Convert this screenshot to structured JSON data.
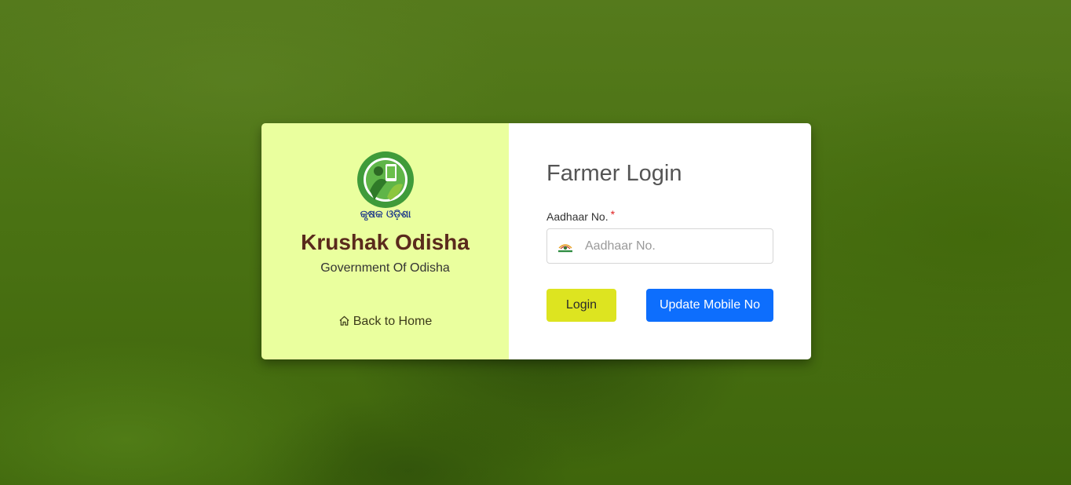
{
  "brand": {
    "logo_text": "କୃଷକ ଓଡ଼ିଶା",
    "title": "Krushak Odisha",
    "subtitle": "Government Of Odisha",
    "back_home_label": "Back to Home",
    "panel_color": "#eaff9e",
    "title_color": "#5a2a1c"
  },
  "form": {
    "title": "Farmer Login",
    "aadhaar_label": "Aadhaar No.",
    "required_marker": "*",
    "aadhaar_value": "",
    "aadhaar_placeholder": "Aadhaar No.",
    "login_label": "Login",
    "update_mobile_label": "Update Mobile No",
    "login_color": "#dde420",
    "update_color": "#0d6efd"
  },
  "icons": {
    "home": "home-icon",
    "aadhaar": "aadhaar-icon",
    "logo": "krushak-odisha-logo"
  }
}
